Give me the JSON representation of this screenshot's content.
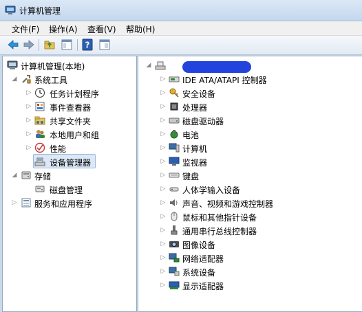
{
  "window": {
    "title": "计算机管理"
  },
  "menu": [
    {
      "label": "文件(F)"
    },
    {
      "label": "操作(A)"
    },
    {
      "label": "查看(V)"
    },
    {
      "label": "帮助(H)"
    }
  ],
  "toolbar": {
    "buttons": [
      "back-icon",
      "forward-icon",
      "up-folder-icon",
      "console-tree-icon",
      "help-icon",
      "properties-icon"
    ]
  },
  "tree": {
    "root": "计算机管理(本地)",
    "system_tools": "系统工具",
    "task_scheduler": "任务计划程序",
    "event_viewer": "事件查看器",
    "shared_folders": "共享文件夹",
    "local_users": "本地用户和组",
    "performance": "性能",
    "device_manager": "设备管理器",
    "storage": "存储",
    "disk_management": "磁盘管理",
    "services_apps": "服务和应用程序"
  },
  "devices": [
    {
      "label": "IDE ATA/ATAPI 控制器",
      "icon": "ide-controller-icon"
    },
    {
      "label": "安全设备",
      "icon": "security-key-icon"
    },
    {
      "label": "处理器",
      "icon": "processor-icon"
    },
    {
      "label": "磁盘驱动器",
      "icon": "disk-drive-icon"
    },
    {
      "label": "电池",
      "icon": "battery-icon"
    },
    {
      "label": "计算机",
      "icon": "computer-icon"
    },
    {
      "label": "监视器",
      "icon": "monitor-icon"
    },
    {
      "label": "键盘",
      "icon": "keyboard-icon"
    },
    {
      "label": "人体学输入设备",
      "icon": "hid-icon"
    },
    {
      "label": "声音、视频和游戏控制器",
      "icon": "speaker-icon"
    },
    {
      "label": "鼠标和其他指针设备",
      "icon": "mouse-icon"
    },
    {
      "label": "通用串行总线控制器",
      "icon": "usb-icon"
    },
    {
      "label": "图像设备",
      "icon": "camera-icon"
    },
    {
      "label": "网络适配器",
      "icon": "network-adapter-icon"
    },
    {
      "label": "系统设备",
      "icon": "system-device-icon"
    },
    {
      "label": "显示适配器",
      "icon": "display-adapter-icon"
    }
  ]
}
